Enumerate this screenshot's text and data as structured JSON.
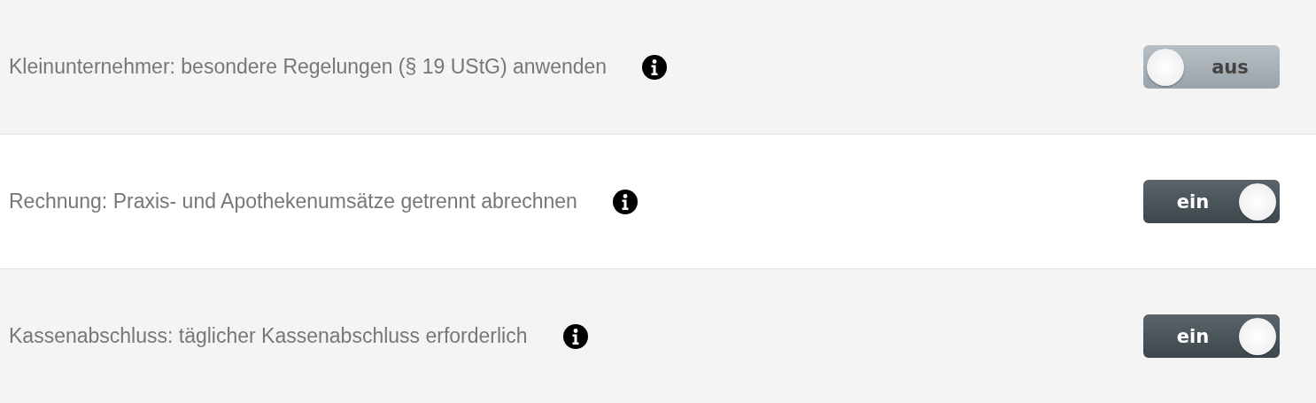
{
  "settings": [
    {
      "label": "Kleinunternehmer: besondere Regelungen (§ 19 UStG) anwenden",
      "toggle": {
        "on": false,
        "text": "aus"
      }
    },
    {
      "label": "Rechnung: Praxis- und Apothekenumsätze getrennt abrechnen",
      "toggle": {
        "on": true,
        "text": "ein"
      }
    },
    {
      "label": "Kassenabschluss: täglicher Kassenabschluss erforderlich",
      "toggle": {
        "on": true,
        "text": "ein"
      }
    }
  ]
}
